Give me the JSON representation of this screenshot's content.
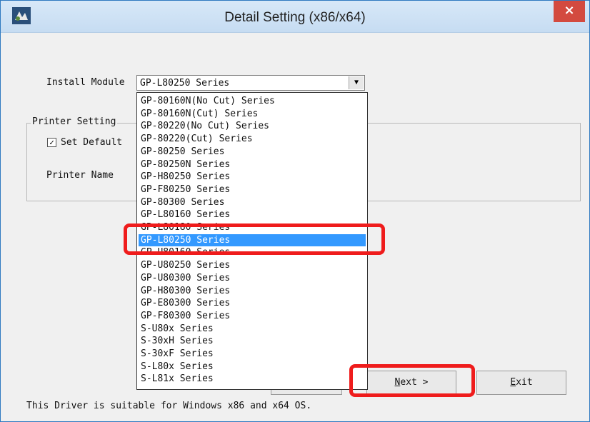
{
  "window": {
    "title": "Detail Setting (x86/x64)",
    "close_label": "×"
  },
  "install_module": {
    "label": "Install Module",
    "selected_value": "GP-L80250 Series",
    "arrow": "▼"
  },
  "printer_setting": {
    "group_title": "Printer Setting",
    "set_default_label": "Set Default",
    "set_default_checked": true,
    "check_mark": "✓",
    "printer_name_label": "Printer Name"
  },
  "dropdown": {
    "items": [
      "GP-80160N(No Cut) Series",
      "GP-80160N(Cut) Series",
      "GP-80220(No Cut) Series",
      "GP-80220(Cut) Series",
      "GP-80250 Series",
      "GP-80250N Series",
      "GP-H80250 Series",
      "GP-F80250 Series",
      "GP-80300 Series",
      "GP-L80160 Series",
      "GP-L80180 Series",
      "GP-L80250 Series",
      "GP-U80160 Series",
      "GP-U80250 Series",
      "GP-U80300 Series",
      "GP-H80300 Series",
      "GP-E80300 Series",
      "GP-F80300 Series",
      "S-U80x Series",
      "S-30xH Series",
      "S-30xF Series",
      "S-L80x Series",
      "S-L81x Series"
    ],
    "selected_index": 11
  },
  "buttons": {
    "next_label": "Next >",
    "next_underline": "N",
    "next_rest": "ext >",
    "exit_label": "Exit",
    "exit_underline": "E",
    "exit_rest": "xit"
  },
  "footer": {
    "text": "This Driver is suitable for Windows x86 and x64 OS."
  },
  "colors": {
    "highlight_box": "#ef1c1c",
    "selection": "#3399ff",
    "close_button": "#d34a3f"
  }
}
